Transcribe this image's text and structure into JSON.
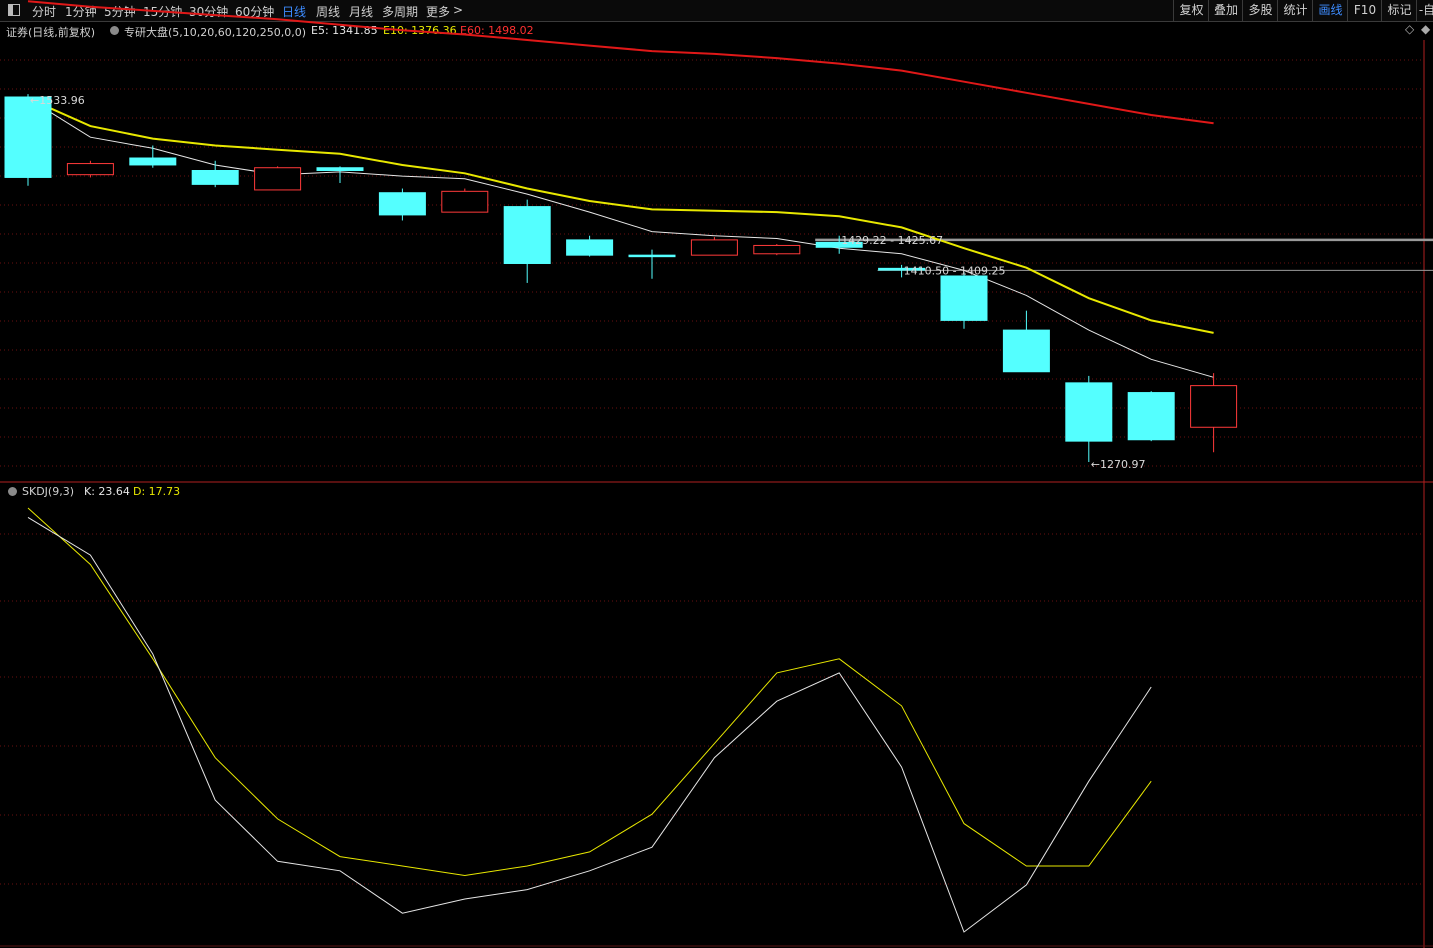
{
  "toolbar": {
    "panel_icon": "panel-toggle-icon",
    "periods": [
      "分时",
      "1分钟",
      "5分钟",
      "15分钟",
      "30分钟",
      "60分钟",
      "日线",
      "周线",
      "月线",
      "多周期",
      "更多"
    ],
    "active_period": "日线",
    "more_arrow": ">",
    "right_buttons": [
      "复权",
      "叠加",
      "多股",
      "统计",
      "画线",
      "F10",
      "标记",
      "-自"
    ],
    "right_active": "画线"
  },
  "info": {
    "security": "证券(日线,前复权)",
    "indicator_name": "专研大盘(5,10,20,60,120,250,0,0)",
    "e5_label": "E5: 1341.85",
    "e10_label": "E10: 1376.36",
    "e60_label": "E60: 1498.02",
    "colors": {
      "e5": "#e6e6e6",
      "e10": "#e8e800",
      "e60": "#ff3030"
    }
  },
  "sub_indicator": {
    "name": "SKDJ(9,3)",
    "k_label": "K: 23.64",
    "d_label": "D: 17.73",
    "colors": {
      "k": "#e6e6e6",
      "d": "#e8e800"
    }
  },
  "chart_data": {
    "type": "candlestick",
    "candles": [
      {
        "o": 1533.96,
        "c": 1476,
        "h": 1536,
        "l": 1470
      },
      {
        "o": 1478,
        "c": 1486,
        "h": 1488,
        "l": 1476
      },
      {
        "o": 1490,
        "c": 1485,
        "h": 1499,
        "l": 1483
      },
      {
        "o": 1481,
        "c": 1471,
        "h": 1488,
        "l": 1469
      },
      {
        "o": 1467,
        "c": 1483,
        "h": 1484,
        "l": 1467
      },
      {
        "o": 1483,
        "c": 1481,
        "h": 1484,
        "l": 1472
      },
      {
        "o": 1465,
        "c": 1449,
        "h": 1468,
        "l": 1445
      },
      {
        "o": 1451,
        "c": 1466,
        "h": 1468,
        "l": 1451
      },
      {
        "o": 1455,
        "c": 1414,
        "h": 1460,
        "l": 1400
      },
      {
        "o": 1431,
        "c": 1420,
        "h": 1434,
        "l": 1419
      },
      {
        "o": 1420,
        "c": 1419,
        "h": 1424,
        "l": 1403
      },
      {
        "o": 1420,
        "c": 1431,
        "h": 1433,
        "l": 1420
      },
      {
        "o": 1421,
        "c": 1427,
        "h": 1428,
        "l": 1420
      },
      {
        "o": 1429.22,
        "c": 1425.67,
        "h": 1434,
        "l": 1421
      },
      {
        "o": 1410.5,
        "c": 1409.25,
        "h": 1413,
        "l": 1404
      },
      {
        "o": 1405,
        "c": 1373,
        "h": 1408,
        "l": 1367
      },
      {
        "o": 1366,
        "c": 1336,
        "h": 1380,
        "l": 1336
      },
      {
        "o": 1328,
        "c": 1286,
        "h": 1333,
        "l": 1270.97
      },
      {
        "o": 1321,
        "c": 1287,
        "h": 1322,
        "l": 1286
      },
      {
        "o": 1296,
        "c": 1326,
        "h": 1335,
        "l": 1278
      }
    ],
    "ma_white": [
      1533,
      1505,
      1497,
      1485,
      1478,
      1480,
      1477,
      1475,
      1464,
      1451,
      1437,
      1434,
      1432,
      1425,
      1421,
      1409,
      1391,
      1366,
      1345,
      1332
    ],
    "ma_yellow": [
      1533,
      1513,
      1504,
      1499,
      1496,
      1493,
      1485,
      1479,
      1468,
      1459,
      1453,
      1452,
      1451,
      1448,
      1440,
      1425,
      1411,
      1389,
      1373,
      1364
    ],
    "ma_red": [
      1603,
      1599,
      1596,
      1593,
      1590,
      1586,
      1582,
      1579,
      1575,
      1571,
      1567,
      1565,
      1562,
      1558,
      1553,
      1545,
      1537,
      1529,
      1521,
      1515
    ],
    "price_range": [
      1270.97,
      1603
    ],
    "annotations": [
      {
        "label": "1533.96",
        "candle": 0,
        "price": 1533.96
      },
      {
        "label": "1429.22 - 1425.67",
        "candle": 13,
        "price": 1431
      },
      {
        "label": "1410.50 - 1409.25",
        "candle": 14,
        "price": 1409
      },
      {
        "label": "1270.97",
        "candle": 17,
        "price": 1270.97
      }
    ],
    "hlines": [
      {
        "price": 1431,
        "from_candle": 13,
        "color": "#9a9a9a",
        "thick": true
      },
      {
        "price": 1409,
        "from_candle": 14,
        "color": "#9a9a9a",
        "thick": false
      }
    ],
    "skdj": {
      "k": [
        96,
        88,
        67,
        36,
        23,
        21,
        12,
        15,
        17,
        21,
        26,
        45,
        57,
        63,
        43,
        8,
        18,
        40,
        60
      ],
      "d": [
        98,
        86,
        66,
        45,
        32,
        24,
        22,
        20,
        22,
        25,
        33,
        48,
        63,
        66,
        56,
        31,
        22,
        22,
        40
      ],
      "range": [
        8,
        98
      ]
    }
  }
}
